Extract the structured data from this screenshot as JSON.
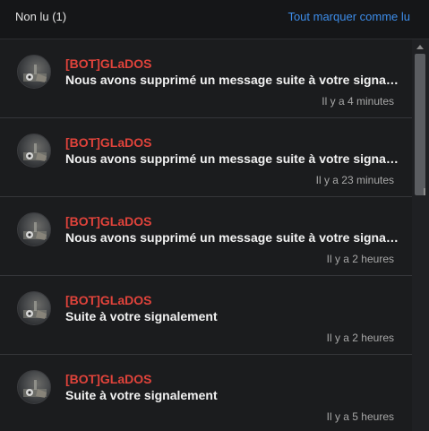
{
  "header": {
    "title": "Non lu (1)",
    "mark_all_read": "Tout marquer comme lu"
  },
  "colors": {
    "author": "#e0433b",
    "link": "#3d8dea",
    "background": "#1b1c1e"
  },
  "notifications": [
    {
      "author": "[BOT]GLaDOS",
      "message": "Nous avons supprimé un message suite à votre signalement",
      "time": "Il y a 4 minutes",
      "avatar_icon": "glados-avatar-icon"
    },
    {
      "author": "[BOT]GLaDOS",
      "message": "Nous avons supprimé un message suite à votre signalement",
      "time": "Il y a 23 minutes",
      "avatar_icon": "glados-avatar-icon"
    },
    {
      "author": "[BOT]GLaDOS",
      "message": "Nous avons supprimé un message suite à votre signalement",
      "time": "Il y a 2 heures",
      "avatar_icon": "glados-avatar-icon"
    },
    {
      "author": "[BOT]GLaDOS",
      "message": "Suite à votre signalement",
      "time": "Il y a 2 heures",
      "avatar_icon": "glados-avatar-icon"
    },
    {
      "author": "[BOT]GLaDOS",
      "message": "Suite à votre signalement",
      "time": "Il y a 5 heures",
      "avatar_icon": "glados-avatar-icon"
    }
  ]
}
